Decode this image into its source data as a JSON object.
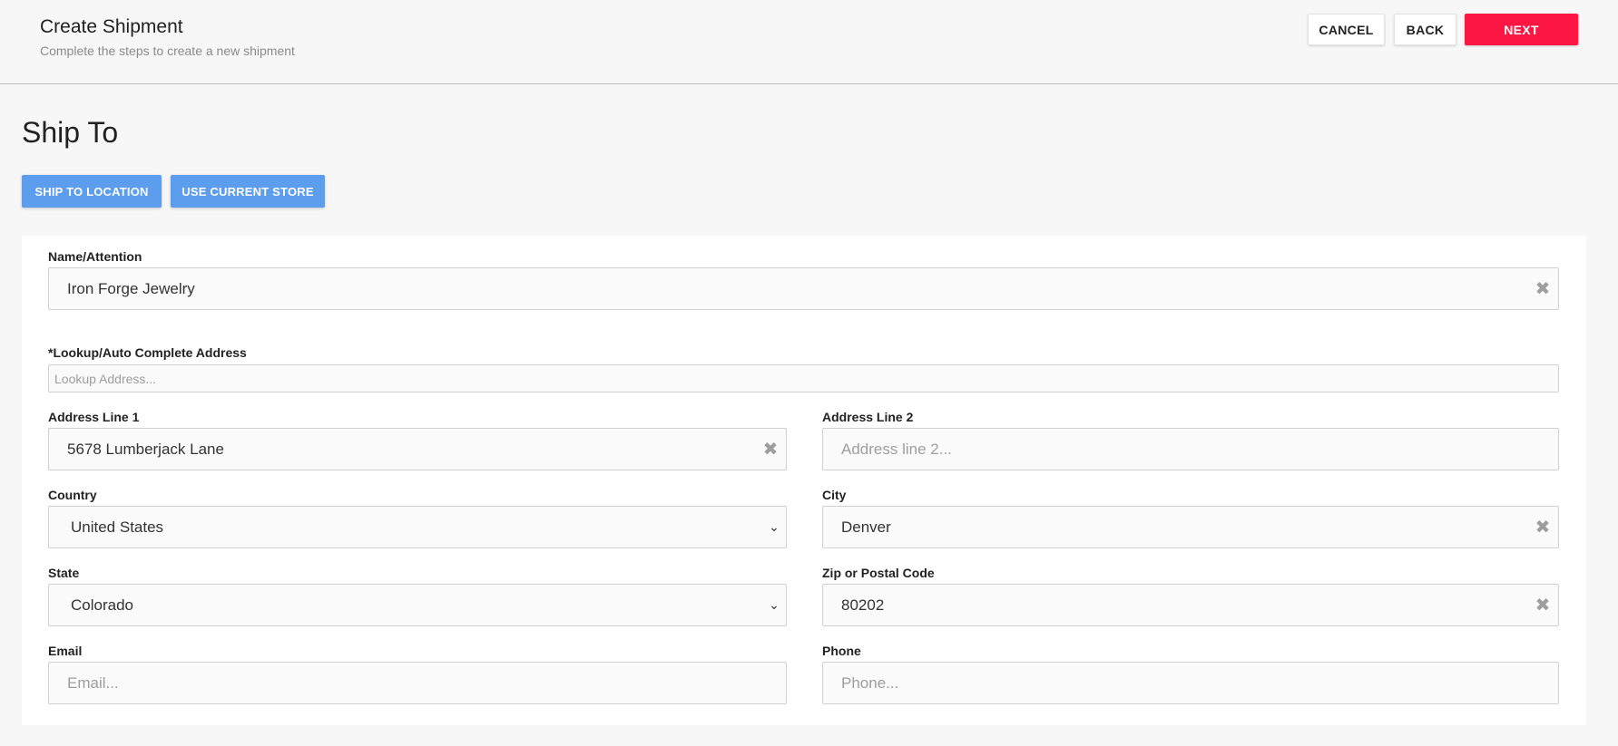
{
  "header": {
    "title": "Create Shipment",
    "subtitle": "Complete the steps to create a new shipment",
    "cancel_label": "CANCEL",
    "back_label": "BACK",
    "next_label": "NEXT"
  },
  "section": {
    "title": "Ship To",
    "ship_to_location_label": "SHIP TO LOCATION",
    "use_current_store_label": "USE CURRENT STORE"
  },
  "form": {
    "name": {
      "label": "Name/Attention",
      "value": "Iron Forge Jewelry"
    },
    "lookup": {
      "label": "*Lookup/Auto Complete Address",
      "placeholder": "Lookup Address..."
    },
    "address1": {
      "label": "Address Line 1",
      "value": "5678 Lumberjack Lane"
    },
    "address2": {
      "label": "Address Line 2",
      "placeholder": "Address line 2..."
    },
    "country": {
      "label": "Country",
      "value": "United States"
    },
    "city": {
      "label": "City",
      "value": "Denver"
    },
    "state": {
      "label": "State",
      "value": "Colorado"
    },
    "zip": {
      "label": "Zip or Postal Code",
      "value": "80202"
    },
    "email": {
      "label": "Email",
      "placeholder": "Email..."
    },
    "phone": {
      "label": "Phone",
      "placeholder": "Phone..."
    }
  },
  "icons": {
    "clear": "close-icon",
    "dropdown": "chevron-down-icon"
  },
  "colors": {
    "primary_action": "#ff1744",
    "secondary_action": "#5c9ded",
    "background": "#f7f7f7"
  }
}
